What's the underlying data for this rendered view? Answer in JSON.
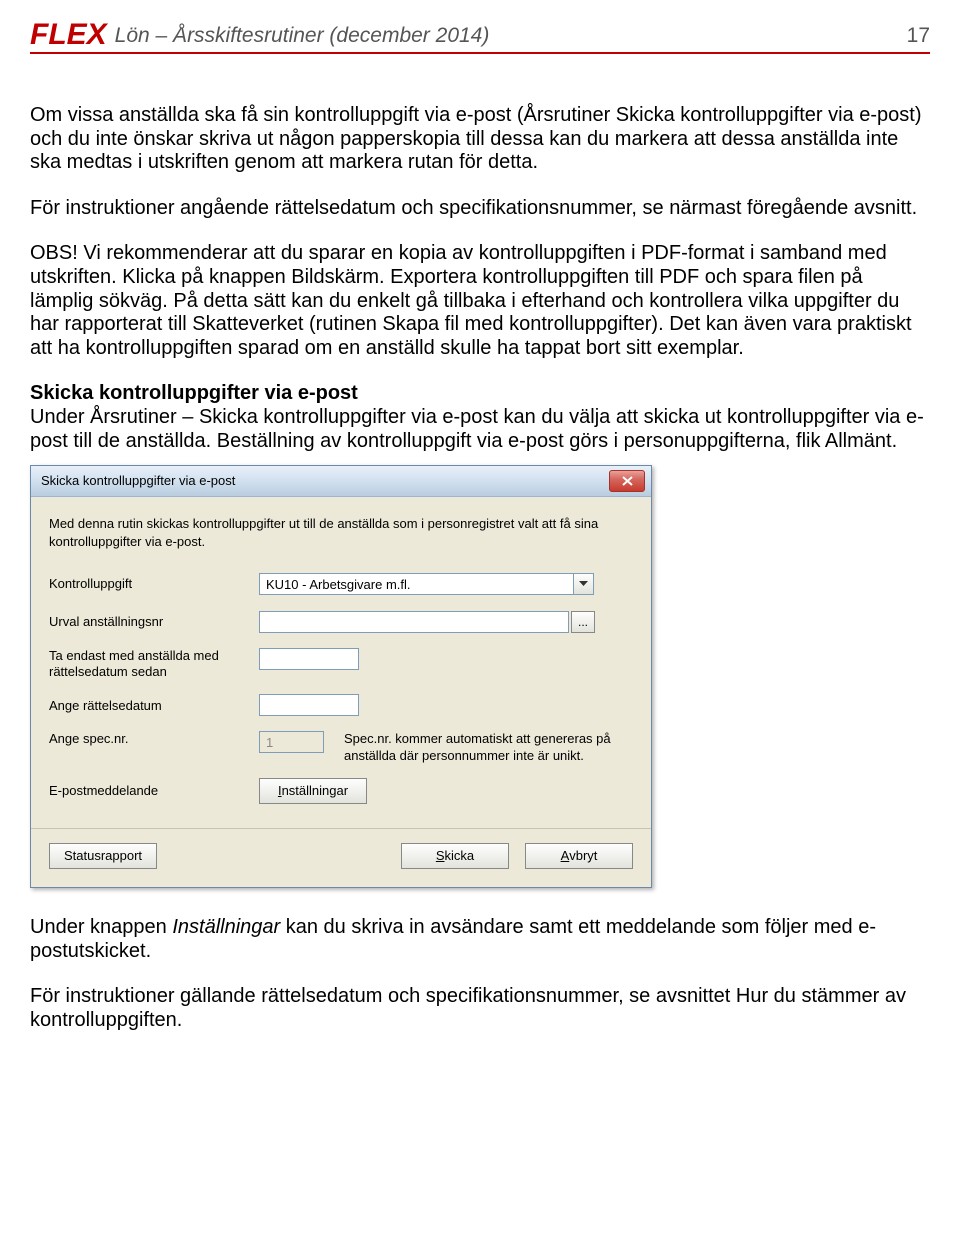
{
  "header": {
    "logo": "FLEX",
    "title": "Lön – Årsskiftesrutiner (december 2014)",
    "page_number": "17"
  },
  "paragraphs": {
    "p1": "Om vissa anställda ska få sin kontrolluppgift via e-post (Årsrutiner Skicka kontrolluppgifter via e-post) och du inte önskar skriva ut någon papperskopia till dessa kan du markera att dessa anställda inte ska medtas i utskriften genom att markera rutan för detta.",
    "p2": "För instruktioner angående rättelsedatum och specifikationsnummer, se närmast föregående avsnitt.",
    "p3": "OBS! Vi rekommenderar att du sparar en kopia av kontrolluppgiften i PDF-format i samband med utskriften. Klicka på knappen Bildskärm. Exportera kontrolluppgiften till PDF och spara filen på lämplig sökväg. På detta sätt kan du enkelt gå tillbaka i efterhand och kontrollera vilka uppgifter du har rapporterat till Skatteverket (rutinen Skapa fil med kontrolluppgifter). Det kan även vara praktiskt att ha kontrolluppgiften sparad om en anställd skulle ha tappat bort sitt exemplar.",
    "h1": "Skicka kontrolluppgifter via e-post",
    "p4": "Under Årsrutiner – Skicka kontrolluppgifter via e-post kan du välja att skicka ut kontrolluppgifter via e-post till de anställda. Beställning av kontrolluppgift via e-post görs i personuppgifterna, flik Allmänt.",
    "p5a": "Under knappen ",
    "p5_italic": "Inställningar",
    "p5b": " kan du skriva in avsändare samt ett meddelande som följer med e-postutskicket.",
    "p6": "För instruktioner gällande rättelsedatum och specifikationsnummer, se avsnittet Hur du stämmer av kontrolluppgiften."
  },
  "dialog": {
    "title": "Skicka kontrolluppgifter via e-post",
    "intro": "Med denna rutin skickas kontrolluppgifter ut till de anställda som i personregistret valt att få sina kontrolluppgifter via e-post.",
    "labels": {
      "kontrolluppgift": "Kontrolluppgift",
      "urval": "Urval anställningsnr",
      "ta_endast": "Ta endast med anställda med rättelsedatum sedan",
      "ange_rattelse": "Ange rättelsedatum",
      "ange_spec": "Ange spec.nr.",
      "epost": "E-postmeddelande"
    },
    "values": {
      "kontrolluppgift": "KU10 - Arbetsgivare m.fl.",
      "urval": "",
      "ta_endast": "",
      "ange_rattelse": "",
      "ange_spec": "1"
    },
    "spec_note": "Spec.nr. kommer automatiskt att genereras på anställda där personnummer inte är unikt.",
    "buttons": {
      "installningar_pre": "I",
      "installningar_rest": "nställningar",
      "statusrapport": "Statusrapport",
      "skicka_pre": "S",
      "skicka_rest": "kicka",
      "avbryt_pre": "A",
      "avbryt_rest": "vbryt",
      "ellipsis": "..."
    }
  }
}
